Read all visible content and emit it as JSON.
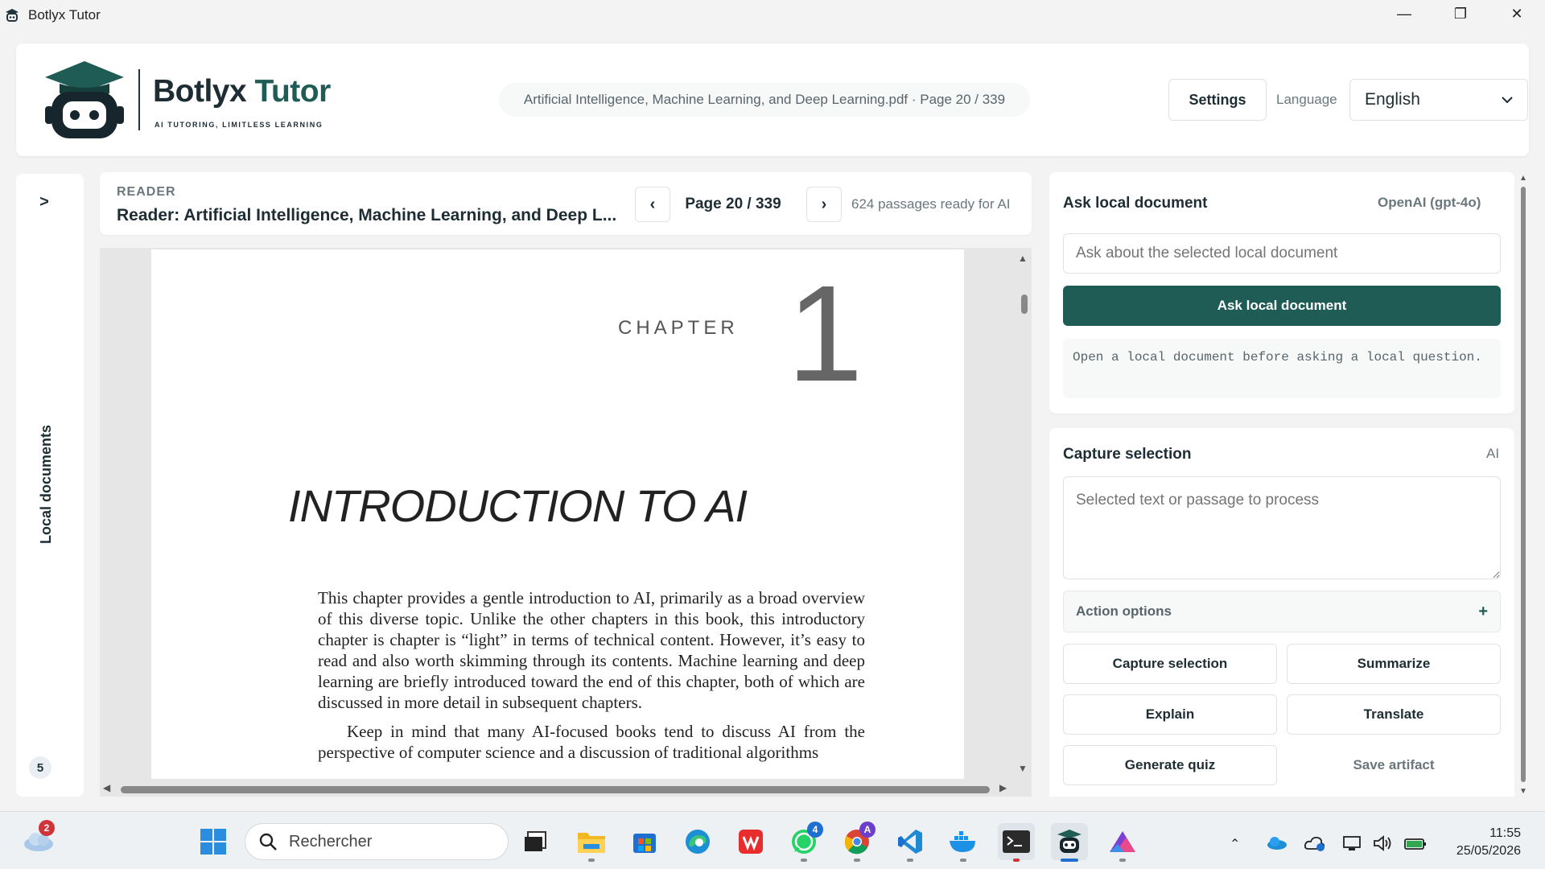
{
  "window": {
    "title": "Botlyx Tutor",
    "controls": {
      "minimize": "—",
      "maximize": "❐",
      "close": "✕"
    }
  },
  "header": {
    "brand_main": "Botlyx ",
    "brand_accent": "Tutor",
    "tagline": "AI TUTORING, LIMITLESS LEARNING",
    "file_info": "Artificial Intelligence, Machine Learning, and Deep Learning.pdf · Page 20 / 339",
    "settings_label": "Settings",
    "language_label": "Language",
    "language_value": "English"
  },
  "sidebar": {
    "toggle": ">",
    "label": "Local documents",
    "count": "5"
  },
  "reader": {
    "kicker": "READER",
    "title": "Reader: Artificial Intelligence, Machine Learning, and Deep L...",
    "prev": "‹",
    "next": "›",
    "page_indicator": "Page 20 / 339",
    "passages": "624 passages ready for AI"
  },
  "pdf": {
    "chapter_word": "CHAPTER",
    "chapter_number": "1",
    "title": "INTRODUCTION TO AI",
    "paragraph_1": "This chapter provides a gentle introduction to AI, primarily as a broad overview of this diverse topic. Unlike the other chapters in this book, this introductory chapter is chapter is “light” in terms of technical content. However, it’s easy to read and also worth skimming through its contents. Machine learning and deep learning are briefly introduced toward the end of this chapter, both of which are discussed in more detail in subsequent chapters.",
    "paragraph_2": "Keep in mind that many AI-focused books tend to discuss AI from the perspective of computer science and a discussion of traditional algorithms"
  },
  "ask_card": {
    "title": "Ask local document",
    "provider": "OpenAI (gpt-4o)",
    "input_placeholder": "Ask about the selected local document",
    "button_label": "Ask local document",
    "note": "Open a local document before asking a local question."
  },
  "capture_card": {
    "title": "Capture selection",
    "meta": "AI",
    "textarea_placeholder": "Selected text or passage to process",
    "accordion_label": "Action options",
    "accordion_icon": "+",
    "actions": {
      "capture": "Capture selection",
      "summarize": "Summarize",
      "explain": "Explain",
      "translate": "Translate",
      "quiz": "Generate quiz",
      "save": "Save artifact"
    }
  },
  "taskbar": {
    "weather_badge": "2",
    "search_placeholder": "Rechercher",
    "whatsapp_badge": "4",
    "chrome_badge": "A",
    "time": "11:55",
    "date": "25/05/2026"
  },
  "colors": {
    "brand": "#1f5c55",
    "text": "#1d2d33",
    "muted": "#6a777c"
  }
}
